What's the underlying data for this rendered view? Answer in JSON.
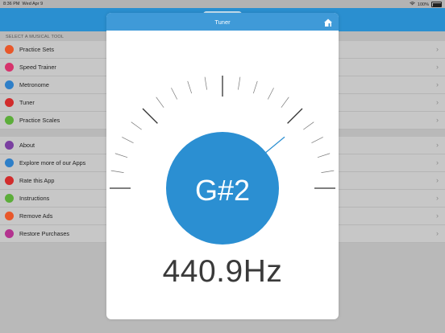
{
  "status": {
    "time": "8:36 PM",
    "date": "Wed Apr 9",
    "battery": "100%"
  },
  "section_header": "SELECT A MUSICAL TOOL",
  "tools": [
    {
      "label": "Practice Sets",
      "icon": "practice-sets-icon",
      "color": "#e8572a"
    },
    {
      "label": "Speed Trainer",
      "icon": "speed-trainer-icon",
      "color": "#d6336c"
    },
    {
      "label": "Metronome",
      "icon": "metronome-icon",
      "color": "#2e7fc8"
    },
    {
      "label": "Tuner",
      "icon": "tuner-icon",
      "color": "#d12c2c"
    },
    {
      "label": "Practice Scales",
      "icon": "practice-scales-icon",
      "color": "#5cad3a"
    }
  ],
  "more": [
    {
      "label": "About",
      "icon": "info-icon",
      "color": "#7a3fa0"
    },
    {
      "label": "Explore more of our Apps",
      "icon": "apps-icon",
      "color": "#2e7fc8"
    },
    {
      "label": "Rate this App",
      "icon": "star-icon",
      "color": "#d12c2c"
    },
    {
      "label": "Instructions",
      "icon": "question-icon",
      "color": "#5cad3a"
    },
    {
      "label": "Remove Ads",
      "icon": "remove-ads-icon",
      "color": "#e8572a"
    },
    {
      "label": "Restore Purchases",
      "icon": "restore-icon",
      "color": "#b3338f"
    }
  ],
  "tuner": {
    "title": "Tuner",
    "note": "G#2",
    "frequency": "440.9Hz",
    "needle_level": 0.78,
    "accent": "#2b8fd2"
  }
}
